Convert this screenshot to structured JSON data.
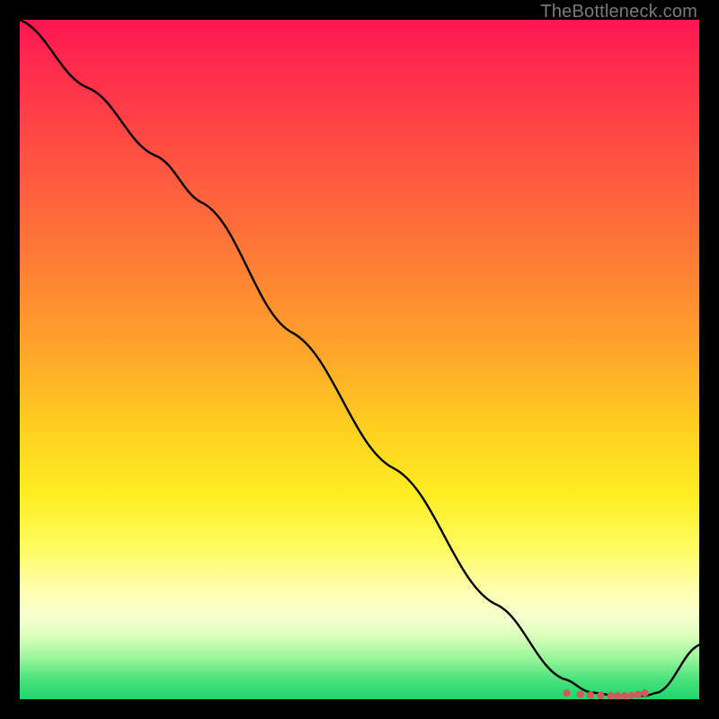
{
  "watermark": "TheBottleneck.com",
  "chart_data": {
    "type": "line",
    "title": "",
    "xlabel": "",
    "ylabel": "",
    "xlim": [
      0,
      100
    ],
    "ylim": [
      0,
      100
    ],
    "series": [
      {
        "name": "curve",
        "x": [
          0,
          10,
          20,
          27,
          40,
          55,
          70,
          80,
          84,
          88,
          92,
          94,
          100
        ],
        "values": [
          100,
          90,
          80,
          73,
          54,
          34,
          14,
          3,
          1,
          0.5,
          0.5,
          1,
          8
        ]
      }
    ],
    "markers": {
      "name": "dots",
      "x": [
        80.5,
        82.5,
        84.0,
        85.5,
        87.0,
        88.0,
        89.0,
        90.0,
        91.0,
        92.0
      ],
      "values": [
        0.9,
        0.7,
        0.6,
        0.55,
        0.5,
        0.5,
        0.5,
        0.55,
        0.7,
        0.9
      ],
      "color": "#cf5a5a"
    },
    "background_gradient": {
      "top": "#ff1552",
      "mid": "#ffee22",
      "bottom": "#1fd66b"
    }
  }
}
